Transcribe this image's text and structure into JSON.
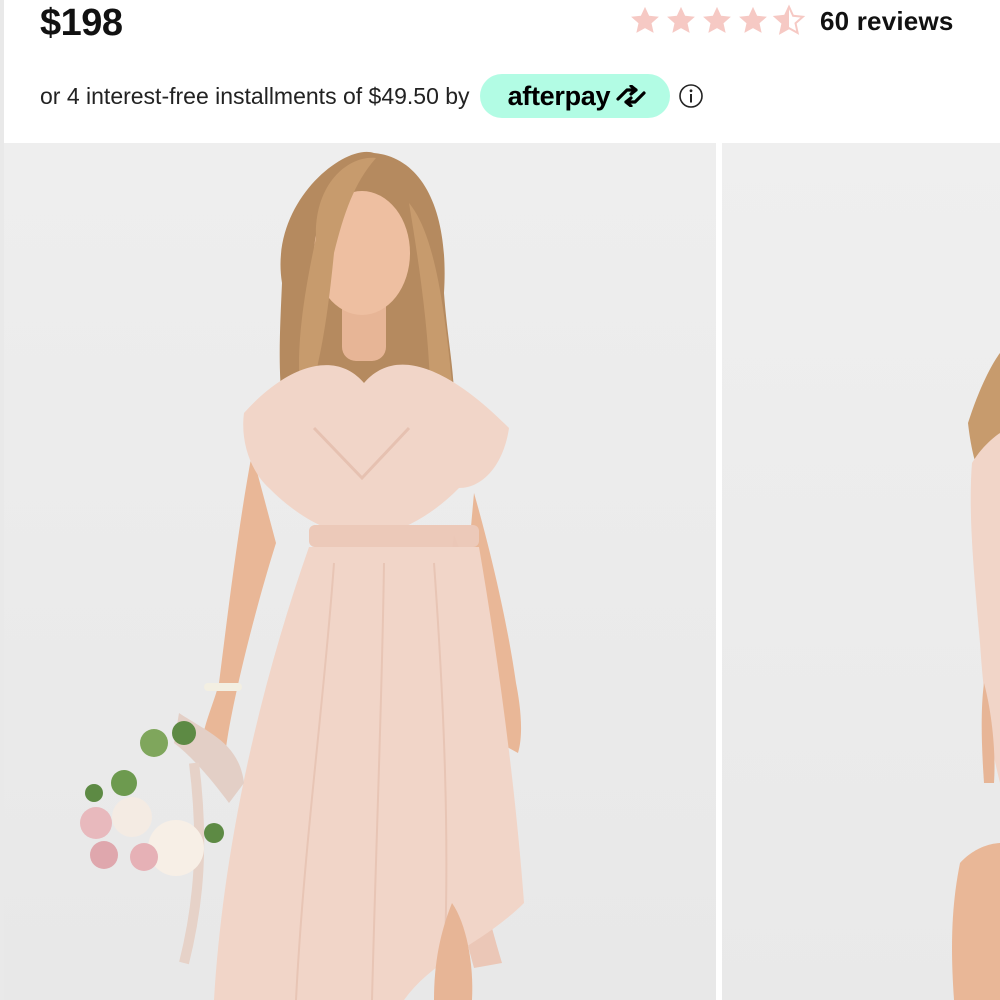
{
  "product": {
    "price": "$198",
    "rating": {
      "value": 4.5,
      "max": 5,
      "star_color": "#f6c9c4",
      "reviews_label": "60 reviews"
    },
    "installments": {
      "text": "or 4 interest-free installments of $49.50 by",
      "provider": "afterpay",
      "badge_color": "#b2fce4",
      "info_icon": "info-icon"
    }
  },
  "gallery": {
    "images": [
      {
        "name": "model-front-photo",
        "dress_color": "#f1d5c8"
      },
      {
        "name": "model-side-photo",
        "dress_color": "#f1d5c8"
      }
    ]
  }
}
